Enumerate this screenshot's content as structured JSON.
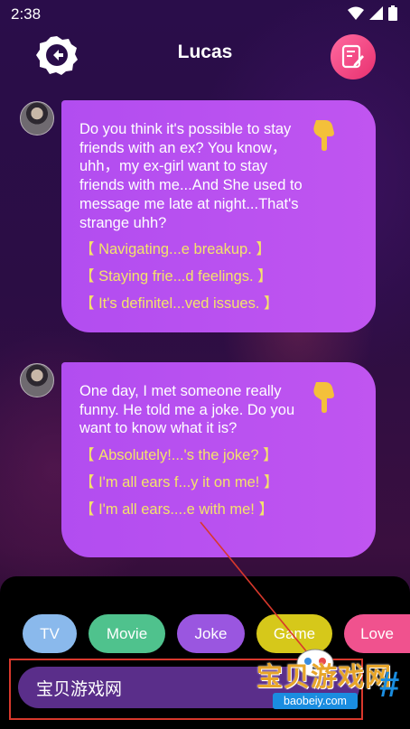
{
  "status_bar": {
    "time": "2:38",
    "icons": [
      "wifi-icon",
      "signal-icon",
      "battery-icon"
    ]
  },
  "header": {
    "title": "Lucas",
    "back_icon": "back-arrow-icon",
    "note_icon": "note-edit-icon"
  },
  "messages": [
    {
      "text": "Do you think it's possible to stay friends with an ex? You know，uhh，my ex-girl want to stay friends with me...And She used to message me late at night...That's strange uhh?",
      "replies": [
        "【 Navigating...e breakup. 】",
        "【 Staying frie...d feelings. 】",
        "【 It's definitel...ved issues. 】"
      ]
    },
    {
      "text": "One day, I met someone really funny. He told me a joke. Do you want to know what it is?",
      "replies": [
        "【 Absolutely!...'s the joke? 】",
        "【 I'm all ears f...y it on me! 】",
        "【 I'm all ears....e with me! 】"
      ]
    }
  ],
  "categories": [
    {
      "label": "TV",
      "color": "#8ab9ec"
    },
    {
      "label": "Movie",
      "color": "#4fc28d"
    },
    {
      "label": "Joke",
      "color": "#9a56e0"
    },
    {
      "label": "Game",
      "color": "#d6c81a"
    },
    {
      "label": "Love",
      "color": "#f0528e"
    }
  ],
  "input": {
    "value": "宝贝游戏网"
  },
  "watermark": {
    "text": "宝贝游戏网",
    "url": "baobeiy.com",
    "hash": "#"
  },
  "colors": {
    "bubble": "#b24df0",
    "reply_text": "#f4e36a",
    "input_bg": "#5a2e8a",
    "highlight": "#d8382c"
  }
}
